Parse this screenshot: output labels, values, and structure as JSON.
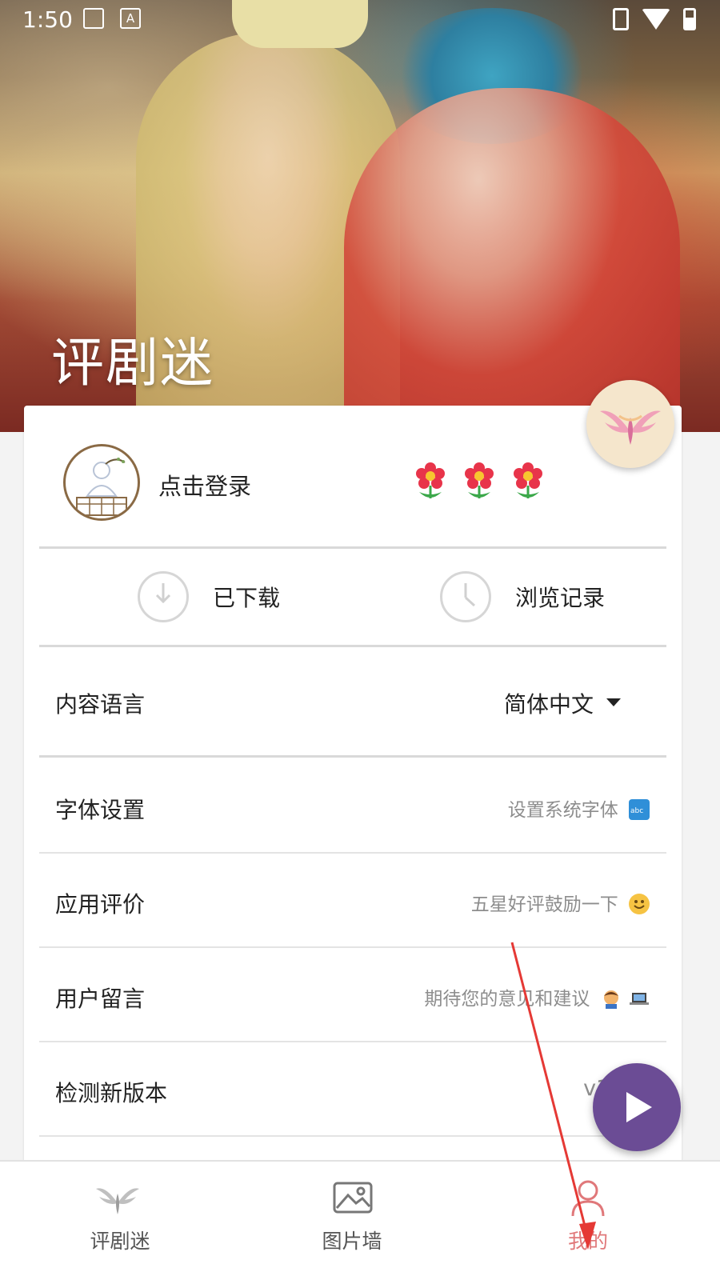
{
  "status_bar": {
    "time": "1:50",
    "icon_a": "A"
  },
  "hero": {
    "title": "评剧迷"
  },
  "profile": {
    "login_text": "点击登录",
    "flowers": [
      "flower-icon",
      "flower-icon",
      "flower-icon"
    ]
  },
  "quick_actions": [
    {
      "label": "已下载",
      "icon": "download-icon"
    },
    {
      "label": "浏览记录",
      "icon": "clock-icon"
    }
  ],
  "settings": {
    "language": {
      "label": "内容语言",
      "value": "简体中文"
    },
    "font": {
      "label": "字体设置",
      "value": "设置系统字体"
    },
    "rate": {
      "label": "应用评价",
      "value": "五星好评鼓励一下"
    },
    "feedback": {
      "label": "用户留言",
      "value": "期待您的意见和建议"
    },
    "update": {
      "label": "检测新版本",
      "value": "v1.5"
    }
  },
  "bottom_nav": [
    {
      "label": "评剧迷",
      "icon": "phoenix-icon",
      "active": false
    },
    {
      "label": "图片墙",
      "icon": "image-icon",
      "active": false
    },
    {
      "label": "我的",
      "icon": "person-icon",
      "active": true
    }
  ],
  "colors": {
    "accent_active": "#e0787a",
    "play_fab": "#6b4c95",
    "annotation_arrow": "#e53935"
  }
}
